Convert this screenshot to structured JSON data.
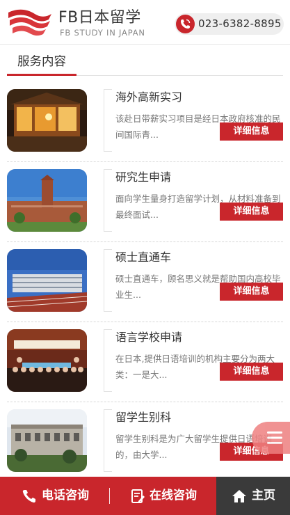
{
  "header": {
    "logo_title": "FB日本留学",
    "logo_subtitle": "FB STUDY IN JAPAN",
    "phone": "023-6382-8895",
    "logo_icon": "red-wave-logo",
    "phone_icon": "phone-icon"
  },
  "section": {
    "title": "服务内容"
  },
  "items": [
    {
      "title": "海外高新实习",
      "desc": "该赴日带薪实习项目是经日本政府核准的民间国际青...",
      "button": "详细信息"
    },
    {
      "title": "研究生申请",
      "desc": "面向学生量身打造留学计划，从材料准备到最终面试...",
      "button": "详细信息"
    },
    {
      "title": "硕士直通车",
      "desc": "硕士直通车，顾名思义就是帮助国内高校毕业生...",
      "button": "详细信息"
    },
    {
      "title": "语言学校申请",
      "desc": "在日本,提供日语培训的机构主要分为两大类：一是大...",
      "button": "详细信息"
    },
    {
      "title": "留学生别科",
      "desc": "留学生别科是为广大留学生提供日语培训的，由大学...",
      "button": "详细信息"
    }
  ],
  "footer": {
    "call": "电话咨询",
    "online": "在线咨询",
    "home": "主页"
  },
  "colors": {
    "accent": "#c9262c",
    "footer_home_bg": "#3a3a3a",
    "float_menu": "#ee8080"
  }
}
